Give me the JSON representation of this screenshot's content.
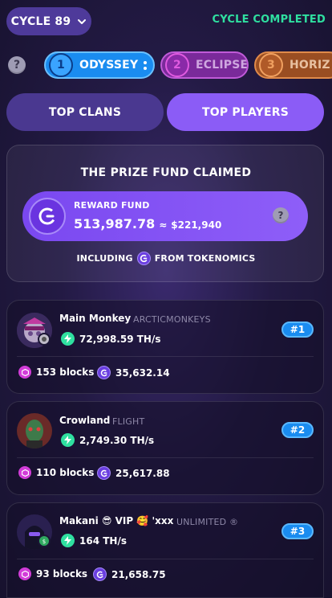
{
  "header": {
    "cycle_label": "CYCLE 89",
    "cycle_status": "CYCLE COMPLETED"
  },
  "leagues": [
    {
      "number": "1",
      "name": "ODYSSEY"
    },
    {
      "number": "2",
      "name": "ECLIPSE"
    },
    {
      "number": "3",
      "name": "HORIZ"
    }
  ],
  "help_glyph": "?",
  "tabs": [
    {
      "label": "TOP CLANS"
    },
    {
      "label": "TOP PLAYERS"
    }
  ],
  "prize": {
    "title": "THE PRIZE FUND CLAIMED",
    "reward_label": "REWARD FUND",
    "amount": "513,987.78",
    "approx": "≈",
    "usd": "$221,940",
    "including_before": "INCLUDING",
    "including_after": "FROM TOKENOMICS"
  },
  "players": [
    {
      "name": "Main Monkey",
      "clan": "ARCTICMONKEYS",
      "power": "72,998.59 TH/s",
      "rank": "#1",
      "blocks": "153 blocks",
      "tokens": "35,632.14"
    },
    {
      "name": "Crowland",
      "clan": "FLIGHT",
      "power": "2,749.30 TH/s",
      "rank": "#2",
      "blocks": "110 blocks",
      "tokens": "25,617.88"
    },
    {
      "name": "Makani 😎 VIP 🥰 'xxx",
      "clan": "UNLIMITED ®",
      "power": "164 TH/s",
      "rank": "#3",
      "blocks": "93 blocks",
      "tokens": "21,658.75"
    }
  ],
  "colors": {
    "accent": "#8b5cf6",
    "status_green": "#2fe0a0",
    "rank_blue": "#1a8cf0"
  }
}
